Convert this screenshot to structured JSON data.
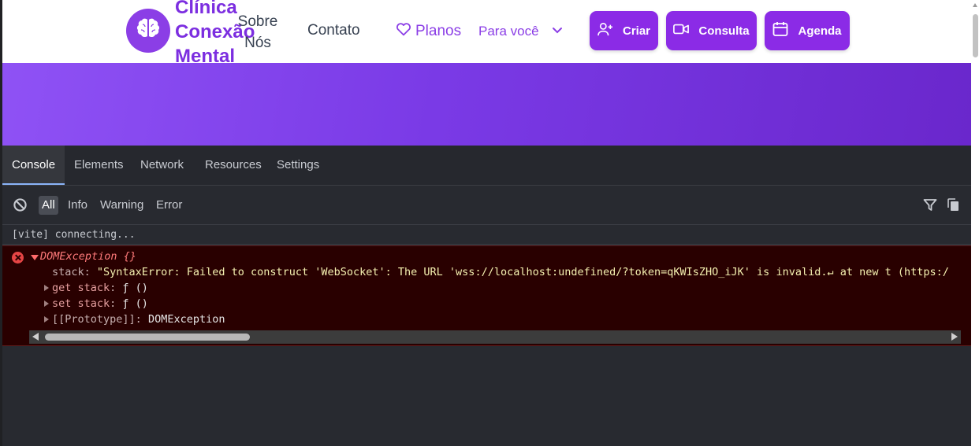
{
  "site": {
    "brand": "Clínica Conexão Mental",
    "nav": {
      "sobre": "Sobre Nós",
      "contato": "Contato",
      "planos": "Planos",
      "para_voce": "Para você"
    },
    "buttons": {
      "criar": "Criar",
      "consulta": "Consulta",
      "agenda": "Agenda"
    },
    "colors": {
      "accent": "#8b2be6",
      "hero_from": "#8f52f5",
      "hero_to": "#6a27cc"
    },
    "icons": [
      "brain-icon",
      "heart-icon",
      "chevron-down-icon",
      "user-plus-icon",
      "video-icon",
      "calendar-icon"
    ]
  },
  "devtools": {
    "tabs": [
      "Console",
      "Elements",
      "Network",
      "Resources",
      "Settings"
    ],
    "active_tab": "Console",
    "filters": [
      "All",
      "Info",
      "Warning",
      "Error"
    ],
    "active_filter": "All",
    "logs": {
      "vite": "[vite] connecting...",
      "error_title": "DOMException {}",
      "stack_key": "stack",
      "stack_value": "\"SyntaxError: Failed to construct 'WebSocket': The URL 'wss://localhost:undefined/?token=qKWIsZHO_iJK' is invalid.↵ at new t (https:/",
      "get_stack": "get stack",
      "set_stack": "set stack",
      "fn": "ƒ ()",
      "prototype_key": "[[Prototype]]",
      "prototype_value": "DOMException"
    },
    "colors": {
      "panel": "#282a30",
      "error_bg": "#290000",
      "error_text": "#ff7a7a"
    }
  }
}
